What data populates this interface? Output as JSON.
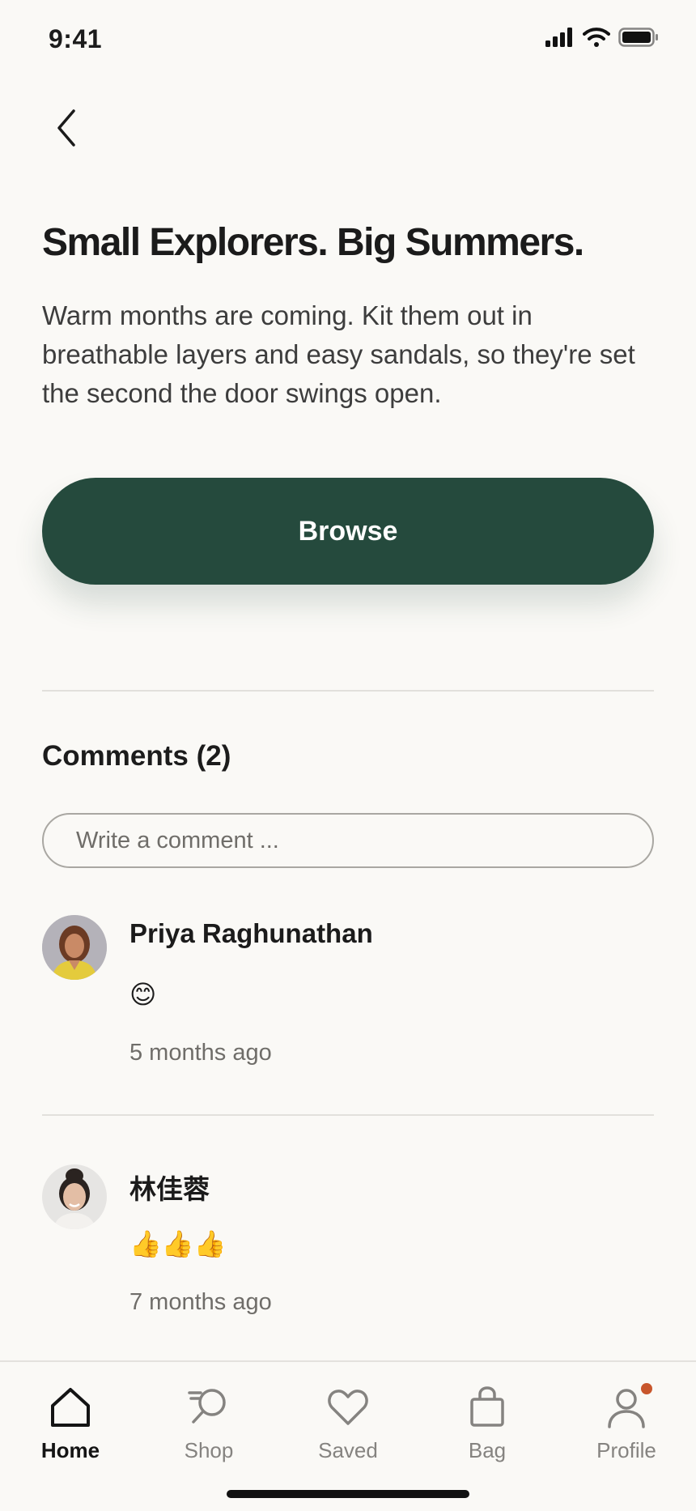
{
  "status_bar": {
    "time": "9:41"
  },
  "article": {
    "title": "Small Explorers. Big Summers.",
    "description": "Warm months are coming. Kit them out in breathable layers and easy sandals, so they're set the second the door swings open.",
    "cta_label": "Browse"
  },
  "comments": {
    "heading": "Comments (2)",
    "input_placeholder": "Write a comment ...",
    "items": [
      {
        "author": "Priya Raghunathan",
        "body": "😊",
        "time": "5 months ago"
      },
      {
        "author": "林佳蓉",
        "body": "👍👍👍",
        "time": "7 months ago"
      }
    ]
  },
  "tab_bar": {
    "items": [
      {
        "label": "Home",
        "icon": "home-icon",
        "active": true
      },
      {
        "label": "Shop",
        "icon": "search-icon",
        "active": false
      },
      {
        "label": "Saved",
        "icon": "heart-icon",
        "active": false
      },
      {
        "label": "Bag",
        "icon": "bag-icon",
        "active": false
      },
      {
        "label": "Profile",
        "icon": "profile-icon",
        "active": false,
        "has_notification": true
      }
    ]
  },
  "colors": {
    "primary_button": "#254a3d",
    "background": "#faf9f6",
    "notification": "#c8562c"
  }
}
